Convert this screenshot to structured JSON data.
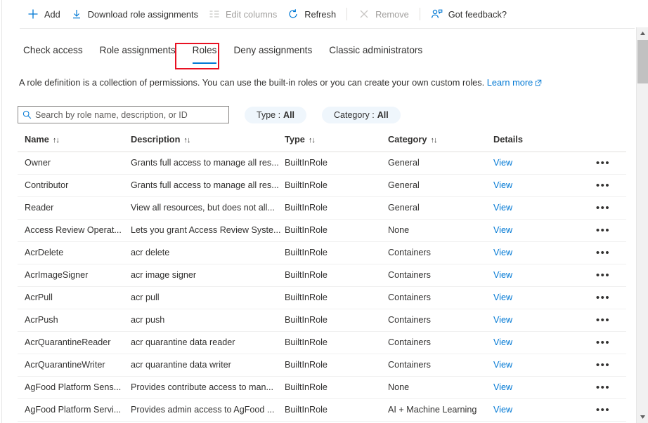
{
  "toolbar": {
    "items": [
      {
        "label": "Add",
        "icon": "plus-icon",
        "disabled": false
      },
      {
        "label": "Download role assignments",
        "icon": "download-icon",
        "disabled": false
      },
      {
        "label": "Edit columns",
        "icon": "edit-columns-icon",
        "disabled": true
      },
      {
        "label": "Refresh",
        "icon": "refresh-icon",
        "disabled": false
      },
      {
        "label": "Remove",
        "icon": "remove-x-icon",
        "disabled": true
      },
      {
        "label": "Got feedback?",
        "icon": "feedback-person-icon",
        "disabled": false
      }
    ]
  },
  "tabs": {
    "items": [
      {
        "label": "Check access",
        "active": false
      },
      {
        "label": "Role assignments",
        "active": false
      },
      {
        "label": "Roles",
        "active": true
      },
      {
        "label": "Deny assignments",
        "active": false
      },
      {
        "label": "Classic administrators",
        "active": false
      }
    ],
    "annotation_color": "#e81123",
    "active_underline_color": "#0078d4"
  },
  "description": {
    "text": "A role definition is a collection of permissions. You can use the built-in roles or you can create your own custom roles.",
    "link_label": "Learn more"
  },
  "search": {
    "placeholder": "Search by role name, description, or ID",
    "value": "",
    "icon": "search-icon"
  },
  "filters": [
    {
      "label": "Type :",
      "value": "All"
    },
    {
      "label": "Category :",
      "value": "All"
    }
  ],
  "table": {
    "columns": [
      {
        "label": "Name",
        "sortable": true
      },
      {
        "label": "Description",
        "sortable": true
      },
      {
        "label": "Type",
        "sortable": true
      },
      {
        "label": "Category",
        "sortable": true
      },
      {
        "label": "Details",
        "sortable": false
      }
    ],
    "sort_glyph": "↑↓",
    "details_link_label": "View",
    "more_glyph": "•••",
    "rows": [
      {
        "name": "Owner",
        "description": "Grants full access to manage all res...",
        "type": "BuiltInRole",
        "category": "General"
      },
      {
        "name": "Contributor",
        "description": "Grants full access to manage all res...",
        "type": "BuiltInRole",
        "category": "General"
      },
      {
        "name": "Reader",
        "description": "View all resources, but does not all...",
        "type": "BuiltInRole",
        "category": "General"
      },
      {
        "name": "Access Review Operat...",
        "description": "Lets you grant Access Review Syste...",
        "type": "BuiltInRole",
        "category": "None"
      },
      {
        "name": "AcrDelete",
        "description": "acr delete",
        "type": "BuiltInRole",
        "category": "Containers"
      },
      {
        "name": "AcrImageSigner",
        "description": "acr image signer",
        "type": "BuiltInRole",
        "category": "Containers"
      },
      {
        "name": "AcrPull",
        "description": "acr pull",
        "type": "BuiltInRole",
        "category": "Containers"
      },
      {
        "name": "AcrPush",
        "description": "acr push",
        "type": "BuiltInRole",
        "category": "Containers"
      },
      {
        "name": "AcrQuarantineReader",
        "description": "acr quarantine data reader",
        "type": "BuiltInRole",
        "category": "Containers"
      },
      {
        "name": "AcrQuarantineWriter",
        "description": "acr quarantine data writer",
        "type": "BuiltInRole",
        "category": "Containers"
      },
      {
        "name": "AgFood Platform Sens...",
        "description": "Provides contribute access to man...",
        "type": "BuiltInRole",
        "category": "None"
      },
      {
        "name": "AgFood Platform Servi...",
        "description": "Provides admin access to AgFood ...",
        "type": "BuiltInRole",
        "category": "AI + Machine Learning"
      }
    ]
  },
  "colors": {
    "accent": "#0078d4",
    "text": "#323130",
    "disabled": "#a19f9d",
    "pill_background": "#eff6fc",
    "row_divider": "#f0f0f0"
  },
  "scrollbar": {
    "up_glyph": "▲",
    "down_glyph": "▼"
  }
}
